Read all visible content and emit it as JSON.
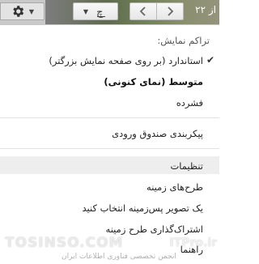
{
  "toolbar": {
    "page_count": "از ۲۲",
    "settings_icon": "gear-icon",
    "lang_icon": "input-tools-icon",
    "prev_icon": "chevron-left-icon",
    "next_icon": "chevron-right-icon"
  },
  "menu": {
    "density_header": "تراکم نمایش:",
    "density_options": [
      {
        "label": "استاندارد (بر روی صفحه نمایش بزرگتر)",
        "checked": true
      },
      {
        "label": "متوسط (نمای کنونی)",
        "current": true
      },
      {
        "label": "فشرده"
      }
    ],
    "configure_inbox": "پیکربندی صندوق ورودی",
    "settings": "تنظیمات",
    "themes": "طرح‌های زمینه",
    "custom_background": "یک تصویر پس‌زمینه انتخاب کنید",
    "share_theme": "اشتراک‌گذاری طرح زمینه",
    "help": "راهنما"
  },
  "watermark": {
    "left": "TOSINSO.COM",
    "right": "ITPro.ir",
    "sub": "انجمن تخصصی فناوری اطلاعات ایران"
  },
  "colors": {
    "toolbar_bg": "#c9c9c9",
    "hover_row": "#eeeeee",
    "text": "#222222"
  }
}
